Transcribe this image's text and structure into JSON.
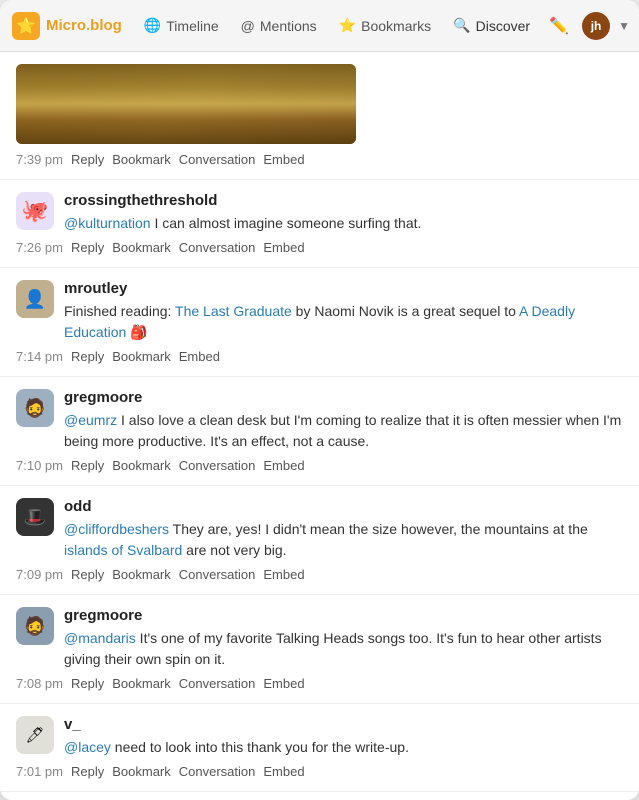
{
  "nav": {
    "logo_label": "Micro.blog",
    "timeline_label": "Timeline",
    "mentions_label": "Mentions",
    "bookmarks_label": "Bookmarks",
    "discover_label": "Discover",
    "compose_icon": "✏️",
    "avatar_initials": "jh"
  },
  "posts": [
    {
      "id": "post-0",
      "has_image": true,
      "username": "",
      "text": "",
      "time": "7:39 pm",
      "actions": [
        "Reply",
        "Bookmark",
        "Conversation",
        "Embed"
      ]
    },
    {
      "id": "post-1",
      "has_image": false,
      "username": "crossingthethreshold",
      "avatar_type": "octopus",
      "avatar_emoji": "🐙",
      "text_parts": [
        {
          "type": "link",
          "text": "@kulturnation",
          "href": "#"
        },
        {
          "type": "text",
          "text": " I can almost imagine someone surfing that."
        }
      ],
      "time": "7:26 pm",
      "actions": [
        "Reply",
        "Bookmark",
        "Conversation",
        "Embed"
      ]
    },
    {
      "id": "post-2",
      "has_image": false,
      "username": "mroutley",
      "avatar_type": "person1",
      "avatar_emoji": "👤",
      "text_parts": [
        {
          "type": "text",
          "text": "Finished reading: "
        },
        {
          "type": "link",
          "text": "The Last Graduate",
          "href": "#"
        },
        {
          "type": "text",
          "text": " by Naomi Novik is a great sequel to "
        },
        {
          "type": "link",
          "text": "A Deadly Education",
          "href": "#"
        },
        {
          "type": "text",
          "text": " 🎒"
        }
      ],
      "time": "7:14 pm",
      "actions": [
        "Reply",
        "Bookmark",
        "Embed"
      ]
    },
    {
      "id": "post-3",
      "has_image": false,
      "username": "gregmoore",
      "avatar_type": "person2",
      "avatar_emoji": "🧔",
      "text_parts": [
        {
          "type": "link",
          "text": "@eumrz",
          "href": "#"
        },
        {
          "type": "text",
          "text": " I also love a clean desk but I'm coming to realize that it is often messier when I'm being more productive. It's an effect, not a cause."
        }
      ],
      "time": "7:10 pm",
      "actions": [
        "Reply",
        "Bookmark",
        "Conversation",
        "Embed"
      ]
    },
    {
      "id": "post-4",
      "has_image": false,
      "username": "odd",
      "avatar_type": "person3",
      "avatar_emoji": "🎩",
      "text_parts": [
        {
          "type": "link",
          "text": "@cliffordbeshers",
          "href": "#"
        },
        {
          "type": "text",
          "text": " They are, yes! I didn't mean the size however, the mountains at the "
        },
        {
          "type": "link",
          "text": "islands of Svalbard",
          "href": "#"
        },
        {
          "type": "text",
          "text": " are not very big."
        }
      ],
      "time": "7:09 pm",
      "actions": [
        "Reply",
        "Bookmark",
        "Conversation",
        "Embed"
      ]
    },
    {
      "id": "post-5",
      "has_image": false,
      "username": "gregmoore",
      "avatar_type": "person4",
      "avatar_emoji": "🧔",
      "text_parts": [
        {
          "type": "link",
          "text": "@mandaris",
          "href": "#"
        },
        {
          "type": "text",
          "text": " It's one of my favorite Talking Heads songs too. It's fun to hear other artists giving their own spin on it."
        }
      ],
      "time": "7:08 pm",
      "actions": [
        "Reply",
        "Bookmark",
        "Conversation",
        "Embed"
      ]
    },
    {
      "id": "post-6",
      "has_image": false,
      "username": "v_",
      "avatar_type": "sketch",
      "avatar_emoji": "🖊️",
      "text_parts": [
        {
          "type": "link",
          "text": "@lacey",
          "href": "#"
        },
        {
          "type": "text",
          "text": " need to look into this thank you for the write-up."
        }
      ],
      "time": "7:01 pm",
      "actions": [
        "Reply",
        "Bookmark",
        "Conversation",
        "Embed"
      ]
    }
  ]
}
